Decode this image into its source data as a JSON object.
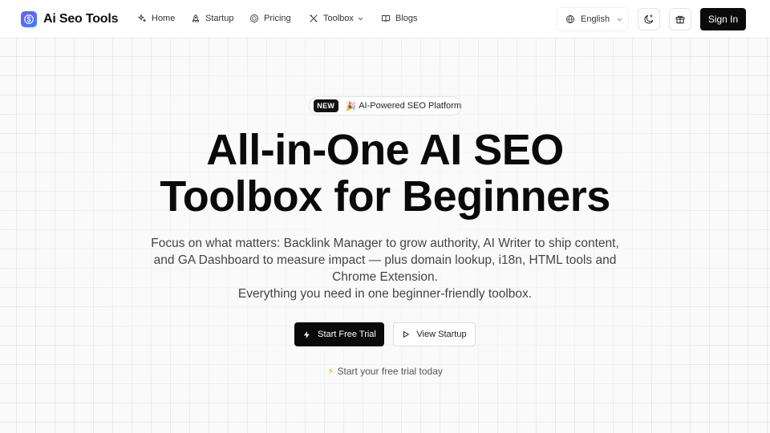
{
  "brand": {
    "name": "Ai Seo Tools",
    "logo_icon": "dollar-badge-icon",
    "accent": "#5b5cf6"
  },
  "nav": {
    "items": [
      {
        "label": "Home",
        "icon": "sparkles-icon"
      },
      {
        "label": "Startup",
        "icon": "rocket-icon"
      },
      {
        "label": "Pricing",
        "icon": "coin-icon"
      },
      {
        "label": "Toolbox",
        "icon": "tools-icon",
        "has_dropdown": true
      },
      {
        "label": "Blogs",
        "icon": "book-icon"
      }
    ],
    "language": {
      "label": "English",
      "icon": "globe-icon"
    },
    "theme_toggle_icon": "moon-sparkle-icon",
    "gift_icon": "gift-icon",
    "signin_label": "Sign In"
  },
  "hero": {
    "badge": {
      "tag": "NEW",
      "emoji": "🎉",
      "text": "AI-Powered SEO Platform"
    },
    "headline": [
      "All-in-One AI SEO",
      "Toolbox for Beginners"
    ],
    "subtext": [
      "Focus on what matters: Backlink Manager to grow authority, AI Writer to ship content,",
      "and GA Dashboard to measure impact — plus domain lookup, i18n, HTML tools and",
      "Chrome Extension.",
      "Everything you need in one beginner-friendly toolbox."
    ],
    "primary_cta": {
      "label": "Start Free Trial",
      "icon": "bolt-icon"
    },
    "secondary_cta": {
      "label": "View Startup",
      "icon": "play-icon"
    },
    "note": {
      "emoji": "⚡",
      "text": "Start your free trial today"
    }
  },
  "colors": {
    "background": "#fafafa",
    "primary_button": "#0a0a0a",
    "grid_line": "#e9e9e9"
  }
}
